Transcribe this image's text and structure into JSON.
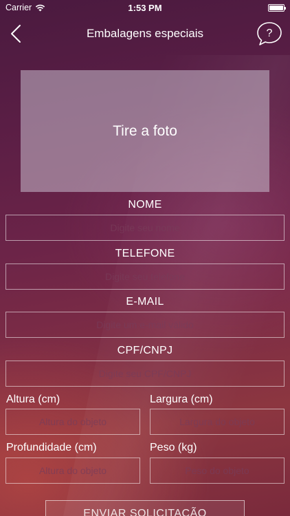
{
  "status_bar": {
    "carrier": "Carrier",
    "time": "1:53 PM",
    "battery_level": 1.0
  },
  "nav": {
    "title": "Embalagens especiais",
    "help_symbol": "?"
  },
  "photo": {
    "label": "Tire a foto"
  },
  "form": {
    "nome": {
      "label": "NOME",
      "placeholder": "Digite seu nome"
    },
    "telefone": {
      "label": "TELEFONE",
      "placeholder": "Digite seu telefone"
    },
    "email": {
      "label": "E-MAIL",
      "placeholder": "Digite um e-mail válido"
    },
    "cpf": {
      "label": "CPF/CNPJ",
      "placeholder": "Digite seu CPF/CNPJ"
    },
    "altura": {
      "label": "Altura (cm)",
      "placeholder": "Altura do objeto"
    },
    "largura": {
      "label": "Largura (cm)",
      "placeholder": "Largura do objeto"
    },
    "profundidade": {
      "label": "Profundidade (cm)",
      "placeholder": "Altura do objeto"
    },
    "peso": {
      "label": "Peso (kg)",
      "placeholder": "Peso do objeto"
    }
  },
  "submit": {
    "label": "ENVIAR SOLICITAÇÃO"
  }
}
